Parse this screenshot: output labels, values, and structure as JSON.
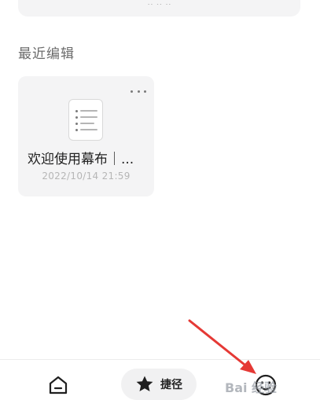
{
  "section": {
    "title": "最近编辑"
  },
  "document": {
    "title": "欢迎使用幕布｜...",
    "date": "2022/10/14 21:59"
  },
  "bottom_nav": {
    "home_icon": "home-icon",
    "shortcut_label": "捷径",
    "shortcut_icon": "star-icon",
    "me_icon": "smiley-icon"
  },
  "watermark": {
    "text": "Bai 经验"
  },
  "colors": {
    "card_bg": "#f4f4f5",
    "arrow": "#e53935",
    "text_primary": "#222222",
    "text_secondary": "#b6b6b6"
  }
}
